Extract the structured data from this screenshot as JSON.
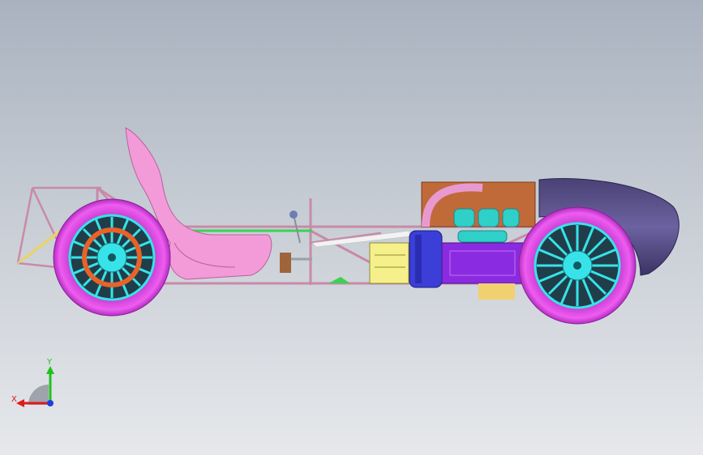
{
  "viewport": {
    "background_top": "#a9b2bf",
    "background_bottom": "#e6e8eb"
  },
  "model": {
    "colors": {
      "frame": "#c98aa8",
      "tyre": "#e24de6",
      "rim": "#37e3e8",
      "nose": "#5b4f8d",
      "seat": "#f29bd8",
      "engine_block": "#8a2be2",
      "rail_green": "#39d353"
    }
  },
  "triad": {
    "x_label": "X",
    "y_label": "Y",
    "x_color": "#e01919",
    "y_color": "#1ec11e",
    "z_color": "#1e3fe0"
  }
}
